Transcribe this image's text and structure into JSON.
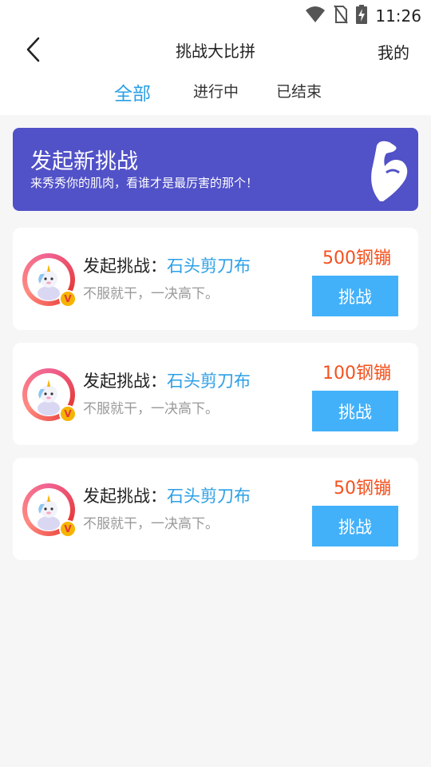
{
  "status_bar": {
    "time": "11:26",
    "icons": [
      "wifi-icon",
      "no-sim-icon",
      "battery-charging-icon"
    ]
  },
  "header": {
    "title": "挑战大比拼",
    "right_link": "我的",
    "back_icon": "chevron-left-icon"
  },
  "tabs": [
    {
      "label": "全部",
      "active": true
    },
    {
      "label": "进行中",
      "active": false
    },
    {
      "label": "已结束",
      "active": false
    }
  ],
  "banner": {
    "title": "发起新挑战",
    "subtitle": "来秀秀你的肌肉，看谁才是最厉害的那个！",
    "icon": "flexed-bicep-icon",
    "bg_color": "#5151c8"
  },
  "challenges": [
    {
      "label_prefix": "发起挑战：",
      "game": "石头剪刀布",
      "desc": "不服就干，一决高下。",
      "amount": "500钢镚",
      "button": "挑战"
    },
    {
      "label_prefix": "发起挑战：",
      "game": "石头剪刀布",
      "desc": "不服就干，一决高下。",
      "amount": "100钢镚",
      "button": "挑战"
    },
    {
      "label_prefix": "发起挑战：",
      "game": "石头剪刀布",
      "desc": "不服就干，一决高下。",
      "amount": "50钢镚",
      "button": "挑战"
    }
  ],
  "colors": {
    "accent": "#2b9fe6",
    "button": "#42b1fa",
    "amount": "#f4511e"
  }
}
